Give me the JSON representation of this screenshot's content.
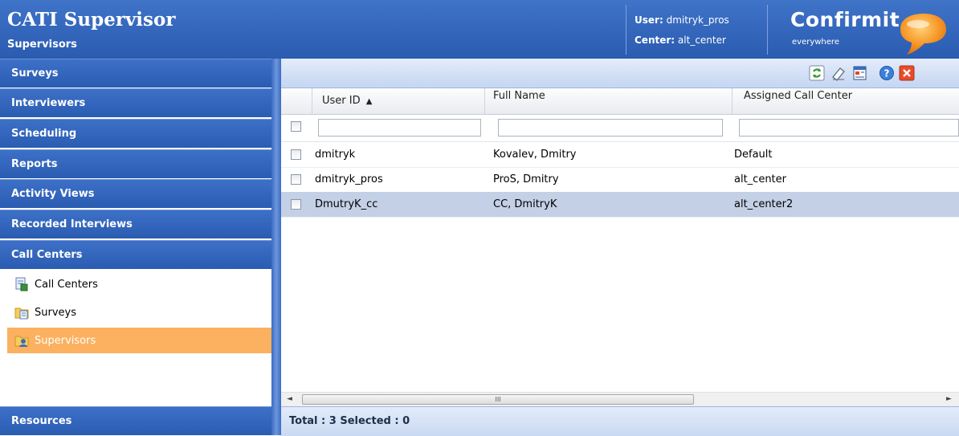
{
  "header": {
    "title": "CATI Supervisor",
    "subtitle": "Supervisors",
    "user_label": "User:",
    "user_value": "dmitryk_pros",
    "center_label": "Center:",
    "center_value": "alt_center",
    "brand": "Confirmit.",
    "tagline": "everywhere"
  },
  "sidebar": {
    "nav": [
      {
        "label": "Surveys"
      },
      {
        "label": "Interviewers"
      },
      {
        "label": "Scheduling"
      },
      {
        "label": "Reports"
      },
      {
        "label": "Activity Views"
      },
      {
        "label": "Recorded Interviews"
      },
      {
        "label": "Call Centers"
      }
    ],
    "sub_items": [
      {
        "label": "Call Centers",
        "icon": "call-centers-icon"
      },
      {
        "label": "Surveys",
        "icon": "surveys-folder-icon"
      },
      {
        "label": "Supervisors",
        "icon": "supervisors-folder-icon",
        "active": true
      }
    ],
    "bottom_nav": {
      "label": "Resources"
    }
  },
  "toolbar": {
    "icons": [
      "refresh-icon",
      "eraser-icon",
      "properties-icon",
      "help-icon",
      "close-icon"
    ]
  },
  "grid": {
    "columns": [
      {
        "label": "User ID",
        "sorted": "ascending",
        "sort_glyph": "▲"
      },
      {
        "label": "Full Name"
      },
      {
        "label": "Assigned Call Center"
      }
    ],
    "rows": [
      {
        "user_id": "dmitryk",
        "full_name": "Kovalev, Dmitry",
        "call_center": "Default",
        "selected": false
      },
      {
        "user_id": "dmitryk_pros",
        "full_name": "ProS, Dmitry",
        "call_center": "alt_center",
        "selected": false
      },
      {
        "user_id": "DmutryK_cc",
        "full_name": "CC, DmitryK",
        "call_center": "alt_center2",
        "selected": true
      }
    ],
    "scroll_left": "◄",
    "scroll_right": "►",
    "scroll_grip": "III"
  },
  "status": {
    "text": "Total : 3 Selected : 0"
  },
  "colors": {
    "header_blue": "#2f63b9",
    "nav_blue": "#3465bb",
    "active_orange": "#fbb160",
    "selected_row": "#c4d0e6"
  }
}
